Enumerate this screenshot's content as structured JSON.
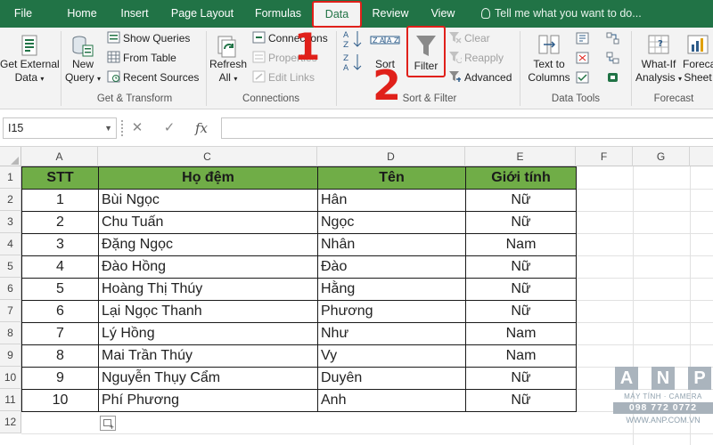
{
  "tabs": [
    "File",
    "Home",
    "Insert",
    "Page Layout",
    "Formulas",
    "Data",
    "Review",
    "View"
  ],
  "active_tab": "Data",
  "tell_me": "Tell me what you want to do...",
  "ribbon": {
    "get_transform": {
      "get_external_data": [
        "Get External",
        "Data"
      ],
      "new_query": [
        "New",
        "Query"
      ],
      "show_queries": "Show Queries",
      "from_table": "From Table",
      "recent_sources": "Recent Sources",
      "label": "Get & Transform"
    },
    "connections": {
      "refresh_all": [
        "Refresh",
        "All"
      ],
      "connections": "Connections",
      "properties": "Properties",
      "edit_links": "Edit Links",
      "label": "Connections"
    },
    "sort_filter": {
      "sort": "Sort",
      "filter": "Filter",
      "clear": "Clear",
      "reapply": "Reapply",
      "advanced": "Advanced",
      "label": "Sort & Filter"
    },
    "data_tools": {
      "text_to_columns": [
        "Text to",
        "Columns"
      ],
      "label": "Data Tools"
    },
    "forecast": {
      "what_if": [
        "What-If",
        "Analysis"
      ],
      "forecast_sheet": [
        "Foreca",
        "Sheet"
      ],
      "label": "Forecast"
    }
  },
  "annotations": {
    "step1": "1",
    "step2": "2"
  },
  "formula_bar": {
    "name_box": "I15",
    "cancel": "✕",
    "enter": "✓",
    "fx": "fx",
    "value": ""
  },
  "grid": {
    "columns": [
      "A",
      "C",
      "D",
      "E",
      "F",
      "G"
    ],
    "rows": [
      "1",
      "2",
      "3",
      "4",
      "5",
      "6",
      "7",
      "8",
      "9",
      "10",
      "11",
      "12"
    ],
    "table": {
      "headers": [
        "STT",
        "Họ đệm",
        "Tên",
        "Giới tính"
      ],
      "rows": [
        [
          "1",
          "Bùi Ngọc",
          "Hân",
          "Nữ"
        ],
        [
          "2",
          "Chu Tuấn",
          "Ngọc",
          "Nữ"
        ],
        [
          "3",
          "Đặng Ngọc",
          "Nhân",
          "Nam"
        ],
        [
          "4",
          "Đào Hồng",
          "Đào",
          "Nữ"
        ],
        [
          "5",
          "Hoàng Thị Thúy",
          "Hằng",
          "Nữ"
        ],
        [
          "6",
          "Lại Ngọc Thanh",
          "Phương",
          "Nữ"
        ],
        [
          "7",
          "Lý Hồng",
          "Như",
          "Nam"
        ],
        [
          "8",
          "Mai Trần Thúy",
          "Vy",
          "Nam"
        ],
        [
          "9",
          "Nguyễn Thụy Cẩm",
          "Duyên",
          "Nữ"
        ],
        [
          "10",
          "Phí Phương",
          "Anh",
          "Nữ"
        ]
      ]
    }
  },
  "watermark": {
    "letters": [
      "A",
      "N",
      "P"
    ],
    "line1": "MÁY TÍNH · CAMERA",
    "line2": "098 772 0772",
    "line3": "WWW.ANP.COM.VN"
  },
  "colors": {
    "excel_green": "#217346",
    "header_fill": "#70ad47",
    "callout_red": "#e0201a"
  }
}
